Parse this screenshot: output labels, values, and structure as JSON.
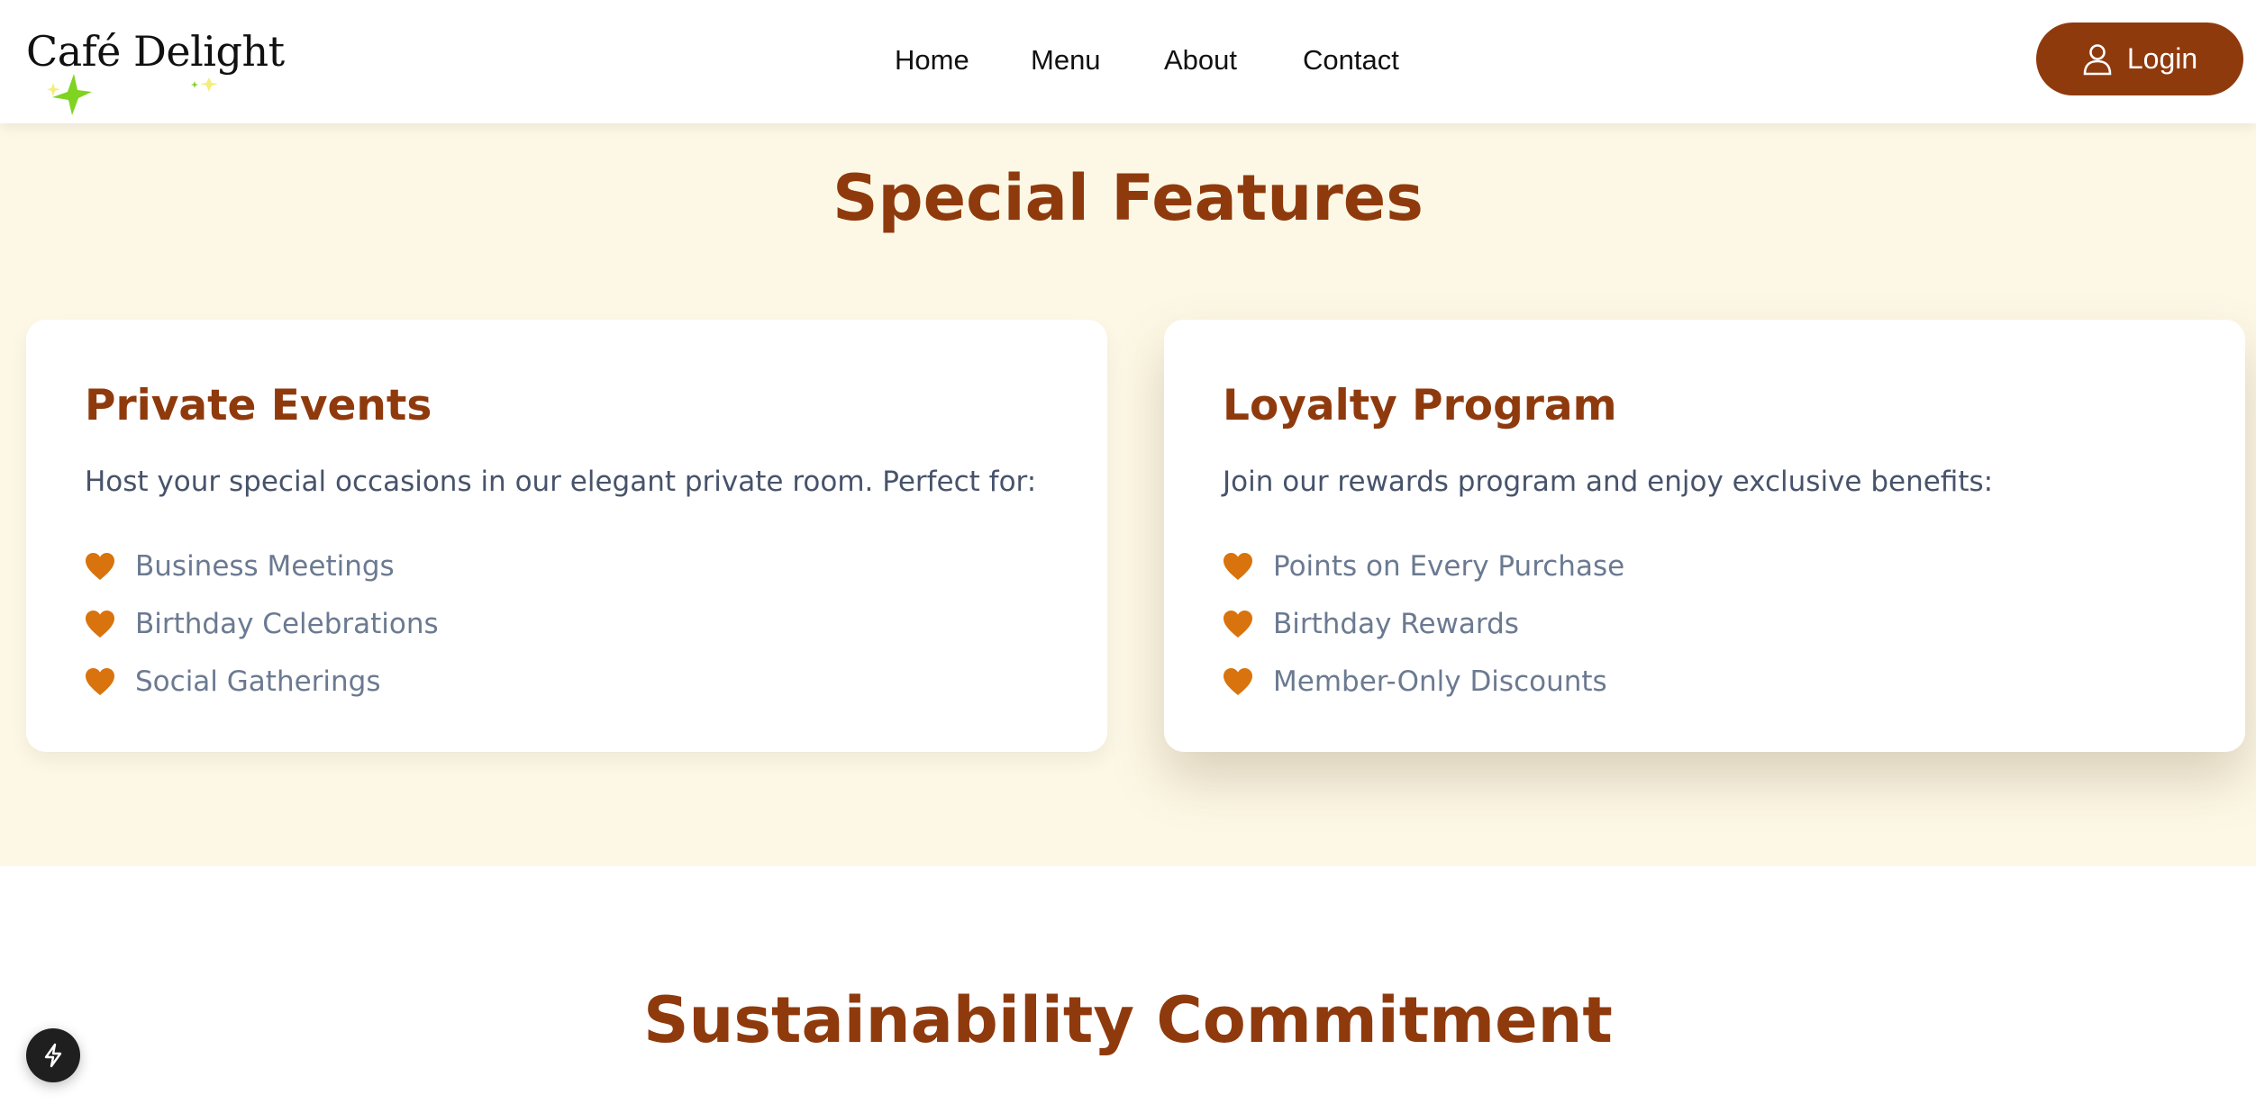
{
  "header": {
    "logo": "Café Delight",
    "nav": [
      "Home",
      "Menu",
      "About",
      "Contact"
    ],
    "login_label": "Login"
  },
  "features": {
    "title": "Special Features",
    "cards": [
      {
        "title": "Private Events",
        "description": "Host your special occasions in our elegant private room. Perfect for:",
        "items": [
          "Business Meetings",
          "Birthday Celebrations",
          "Social Gatherings"
        ]
      },
      {
        "title": "Loyalty Program",
        "description": "Join our rewards program and enjoy exclusive benefits:",
        "items": [
          "Points on Every Purchase",
          "Birthday Rewards",
          "Member-Only Discounts"
        ]
      }
    ]
  },
  "sustainability": {
    "title": "Sustainability Commitment"
  },
  "icons": {
    "login": "user-icon",
    "list_bullet": "heart-icon",
    "fab": "lightning-icon",
    "logo_decoration": "sparkle-icon"
  },
  "colors": {
    "brand": "#8f3a0d",
    "heart": "#d9730d",
    "section_bg": "#fdf8e6",
    "sparkle": "#7fd321"
  }
}
